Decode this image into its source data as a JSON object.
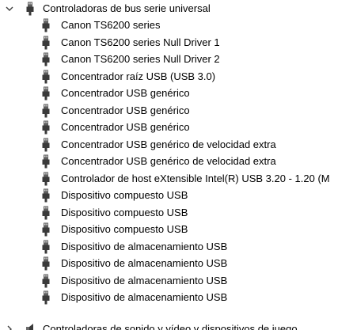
{
  "tree": {
    "category_usb": {
      "label": "Controladoras de bus serie universal",
      "expanded": true,
      "icon": "usb-plug-icon",
      "chevron_icon": "chevron-down-icon",
      "devices": [
        {
          "label": "Canon TS6200 series",
          "icon": "usb-plug-icon"
        },
        {
          "label": "Canon TS6200 series Null Driver 1",
          "icon": "usb-plug-icon"
        },
        {
          "label": "Canon TS6200 series Null Driver 2",
          "icon": "usb-plug-icon"
        },
        {
          "label": "Concentrador raíz USB (USB 3.0)",
          "icon": "usb-plug-icon"
        },
        {
          "label": "Concentrador USB genérico",
          "icon": "usb-plug-icon"
        },
        {
          "label": "Concentrador USB genérico",
          "icon": "usb-plug-icon"
        },
        {
          "label": "Concentrador USB genérico",
          "icon": "usb-plug-icon"
        },
        {
          "label": "Concentrador USB genérico de velocidad extra",
          "icon": "usb-plug-icon"
        },
        {
          "label": "Concentrador USB genérico de velocidad extra",
          "icon": "usb-plug-icon"
        },
        {
          "label": "Controlador de host eXtensible Intel(R) USB 3.20 - 1.20 (M",
          "icon": "usb-plug-icon"
        },
        {
          "label": "Dispositivo compuesto USB",
          "icon": "usb-plug-icon"
        },
        {
          "label": "Dispositivo compuesto USB",
          "icon": "usb-plug-icon"
        },
        {
          "label": "Dispositivo compuesto USB",
          "icon": "usb-plug-icon"
        },
        {
          "label": "Dispositivo de almacenamiento USB",
          "icon": "usb-plug-icon"
        },
        {
          "label": "Dispositivo de almacenamiento USB",
          "icon": "usb-plug-icon"
        },
        {
          "label": "Dispositivo de almacenamiento USB",
          "icon": "usb-plug-icon"
        },
        {
          "label": "Dispositivo de almacenamiento USB",
          "icon": "usb-plug-icon"
        }
      ]
    },
    "category_sound": {
      "label": "Controladoras de sonido y vídeo y dispositivos de juego",
      "expanded": false,
      "icon": "speaker-icon",
      "chevron_icon": "chevron-right-icon"
    }
  },
  "colors": {
    "text": "#000000",
    "icon_dark": "#3a3a3a",
    "icon_mid": "#6b6b6b",
    "chevron": "#404040"
  }
}
